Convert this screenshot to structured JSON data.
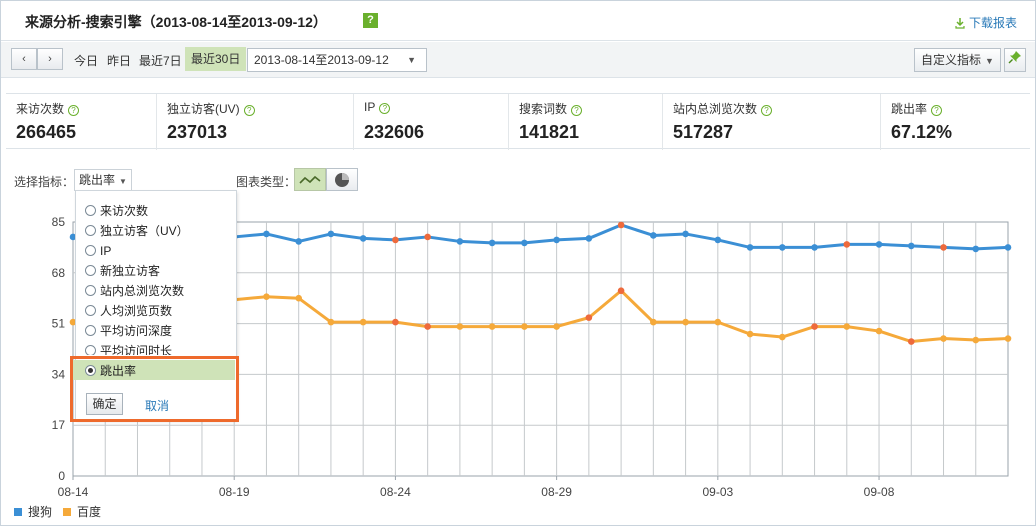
{
  "header": {
    "title": "来源分析-搜索引擎（2013-08-14至2013-09-12）",
    "help": "?",
    "download_label": "下载报表"
  },
  "toolbar": {
    "prev": "‹",
    "next": "›",
    "ranges": [
      "今日",
      "昨日",
      "最近7日",
      "最近30日"
    ],
    "active_range": "最近30日",
    "date_range": "2013-08-14至2013-09-12",
    "custom_metric_label": "自定义指标"
  },
  "metrics": [
    {
      "label": "来访次数",
      "value": "266465"
    },
    {
      "label": "独立访客(UV)",
      "value": "237013"
    },
    {
      "label": "IP",
      "value": "232606"
    },
    {
      "label": "搜索词数",
      "value": "141821"
    },
    {
      "label": "站内总浏览次数",
      "value": "517287"
    },
    {
      "label": "跳出率",
      "value": "67.12%"
    }
  ],
  "chart_controls": {
    "select_metric_label": "选择指标：",
    "selected_metric": "跳出率",
    "chart_type_label": "图表类型："
  },
  "metric_popup": {
    "options": [
      "来访次数",
      "独立访客（UV）",
      "IP",
      "新独立访客",
      "站内总浏览次数",
      "人均浏览页数",
      "平均访问深度",
      "平均访问时长",
      "跳出率"
    ],
    "selected": "跳出率",
    "confirm_label": "确定",
    "cancel_label": "取消"
  },
  "colors": {
    "sogou": "#3b8fd5",
    "baidu": "#f5a93a",
    "accent_green": "#cfe3b8",
    "highlight_orange": "#ee6a2c",
    "point_red": "#ee6a3c"
  },
  "chart_data": {
    "type": "line",
    "ylim": [
      0,
      85
    ],
    "yticks": [
      0,
      17,
      34,
      51,
      68,
      85
    ],
    "x": [
      "08-14",
      "08-15",
      "08-16",
      "08-17",
      "08-18",
      "08-19",
      "08-20",
      "08-21",
      "08-22",
      "08-23",
      "08-24",
      "08-25",
      "08-26",
      "08-27",
      "08-28",
      "08-29",
      "08-30",
      "08-31",
      "09-01",
      "09-02",
      "09-03",
      "09-04",
      "09-05",
      "09-06",
      "09-07",
      "09-08",
      "09-09",
      "09-10",
      "09-11",
      "09-12"
    ],
    "xtick_labels": [
      "08-14",
      "08-19",
      "08-24",
      "08-29",
      "09-03",
      "09-08"
    ],
    "series": [
      {
        "name": "搜狗",
        "color": "#3b8fd5",
        "values": [
          80,
          81,
          81,
          80.5,
          80.5,
          80,
          81,
          78.5,
          81,
          79.5,
          79,
          80,
          78.5,
          78,
          78,
          79,
          79.5,
          84,
          80.5,
          81,
          79,
          76.5,
          76.5,
          76.5,
          77.5,
          77.5,
          77,
          76.5,
          76,
          76.5
        ]
      },
      {
        "name": "百度",
        "color": "#f5a93a",
        "values": [
          51.5,
          51,
          51,
          51,
          51,
          59,
          60,
          59.5,
          51.5,
          51.5,
          51.5,
          50,
          50,
          50,
          50,
          50,
          53,
          62,
          51.5,
          51.5,
          51.5,
          47.5,
          46.5,
          50,
          50,
          48.5,
          45,
          46,
          45.5,
          46
        ]
      }
    ],
    "highlight_points": [
      {
        "series": "搜狗",
        "indices": [
          10,
          11,
          17,
          24,
          27
        ]
      },
      {
        "series": "百度",
        "indices": [
          10,
          11,
          16,
          17,
          23,
          26
        ]
      }
    ]
  }
}
